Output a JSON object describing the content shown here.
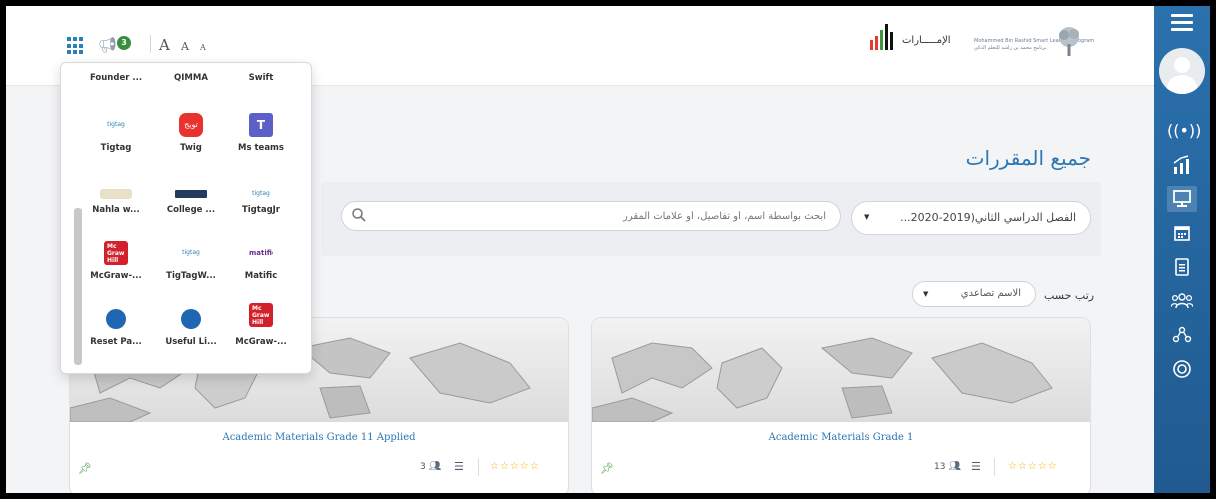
{
  "header": {
    "announcement_count": "3",
    "font_sizes": [
      "A",
      "A",
      "A"
    ],
    "uae_logo_text": "الإمـــــارات",
    "msl_logo_line1": "Mohammed Bin Rashid Smart Learning Program",
    "msl_logo_line2": "برنامج محمد بن راشد للتعلم الذكي"
  },
  "sidebar": {
    "icons": [
      "menu-icon",
      "avatar",
      "live-icon",
      "chart-icon",
      "monitor-icon",
      "calendar-icon",
      "document-icon",
      "users-icon",
      "share-icon",
      "lifebuoy-icon"
    ],
    "active": "monitor-icon",
    "color": "#2b71ad"
  },
  "page": {
    "title": "جميع المقررات"
  },
  "filters": {
    "semester": "الفصل الدراسي الثاني(2019-2020...",
    "search_placeholder": "ابحث بواسطة اسم، أو تفاصيل، أو علامات المقرر"
  },
  "sort": {
    "label": "رتب حسب",
    "value": "الاسم تصاعدي"
  },
  "courses": [
    {
      "title": "Academic Materials Grade 1",
      "students": "13"
    },
    {
      "title": "Academic Materials Grade 11 Applied",
      "students": "3"
    }
  ],
  "apps_popup": {
    "apps": [
      {
        "label": "Founder ...",
        "icon": "none"
      },
      {
        "label": "QIMMA",
        "icon": "none"
      },
      {
        "label": "Swift",
        "icon": "none"
      },
      {
        "label": "Tigtag",
        "icon": "tigtag-logo"
      },
      {
        "label": "Twig",
        "icon": "twig-logo"
      },
      {
        "label": "Ms teams",
        "icon": "teams-logo"
      },
      {
        "label": "Nahla w...",
        "icon": "nahla-logo"
      },
      {
        "label": "College ...",
        "icon": "college-logo"
      },
      {
        "label": "TigtagJr",
        "icon": "tigtagjr-logo"
      },
      {
        "label": "McGraw-...",
        "icon": "mcgraw-logo"
      },
      {
        "label": "TigTagW...",
        "icon": "tigtag-logo"
      },
      {
        "label": "Matific",
        "icon": "matific-logo"
      },
      {
        "label": "Reset Pa...",
        "icon": "useful-links-logo"
      },
      {
        "label": "Useful Li...",
        "icon": "useful-links-logo"
      },
      {
        "label": "McGraw-...",
        "icon": "mcgraw-logo"
      }
    ],
    "logo_text": {
      "tigtag": "tigtag",
      "twig": "تويج",
      "mcgraw": "Mc Graw Hill",
      "matific": "matific"
    }
  }
}
